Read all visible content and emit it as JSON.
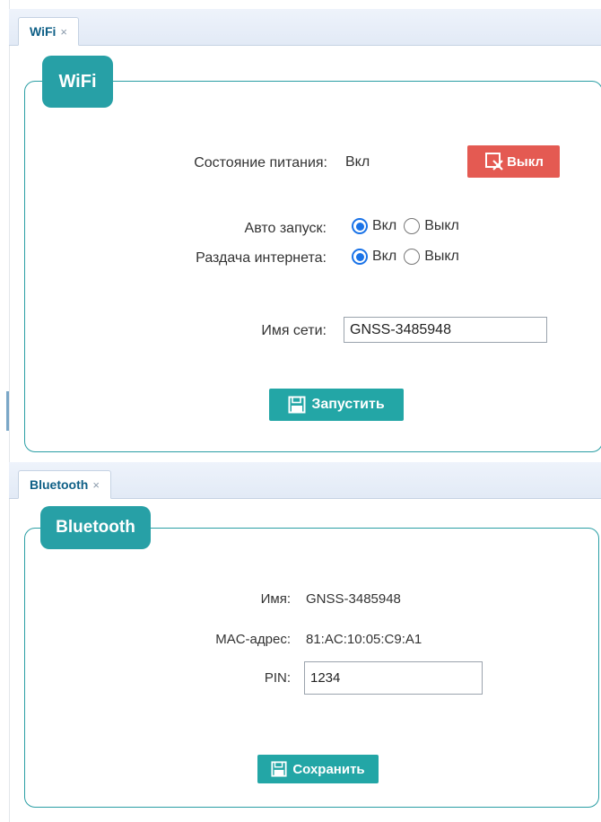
{
  "wifi": {
    "tab_label": "WiFi",
    "tab_close": "×",
    "legend": "WiFi",
    "power_label": "Состояние питания:",
    "power_value": "Вкл",
    "off_button": "Выкл",
    "autostart_label": "Авто запуск:",
    "autostart_options": [
      {
        "label": "Вкл",
        "checked": true
      },
      {
        "label": "Выкл",
        "checked": false
      }
    ],
    "sharing_label": "Раздача интернета:",
    "sharing_options": [
      {
        "label": "Вкл",
        "checked": true
      },
      {
        "label": "Выкл",
        "checked": false
      }
    ],
    "ssid_label": "Имя сети:",
    "ssid_value": "GNSS-3485948",
    "start_button": "Запустить"
  },
  "bluetooth": {
    "tab_label": "Bluetooth",
    "tab_close": "×",
    "legend": "Bluetooth",
    "name_label": "Имя:",
    "name_value": "GNSS-3485948",
    "mac_label": "MAC-адрес:",
    "mac_value": "81:AC:10:05:C9:A1",
    "pin_label": "PIN:",
    "pin_value": "1234",
    "save_button": "Сохранить"
  },
  "colors": {
    "accent": "#27a0a6",
    "danger": "#e45a52",
    "radio_checked": "#1a73e8",
    "tab_text": "#0e5f86"
  },
  "icons": {
    "off_button_icon": "close-window-icon",
    "save_icon": "floppy-disk-icon"
  }
}
